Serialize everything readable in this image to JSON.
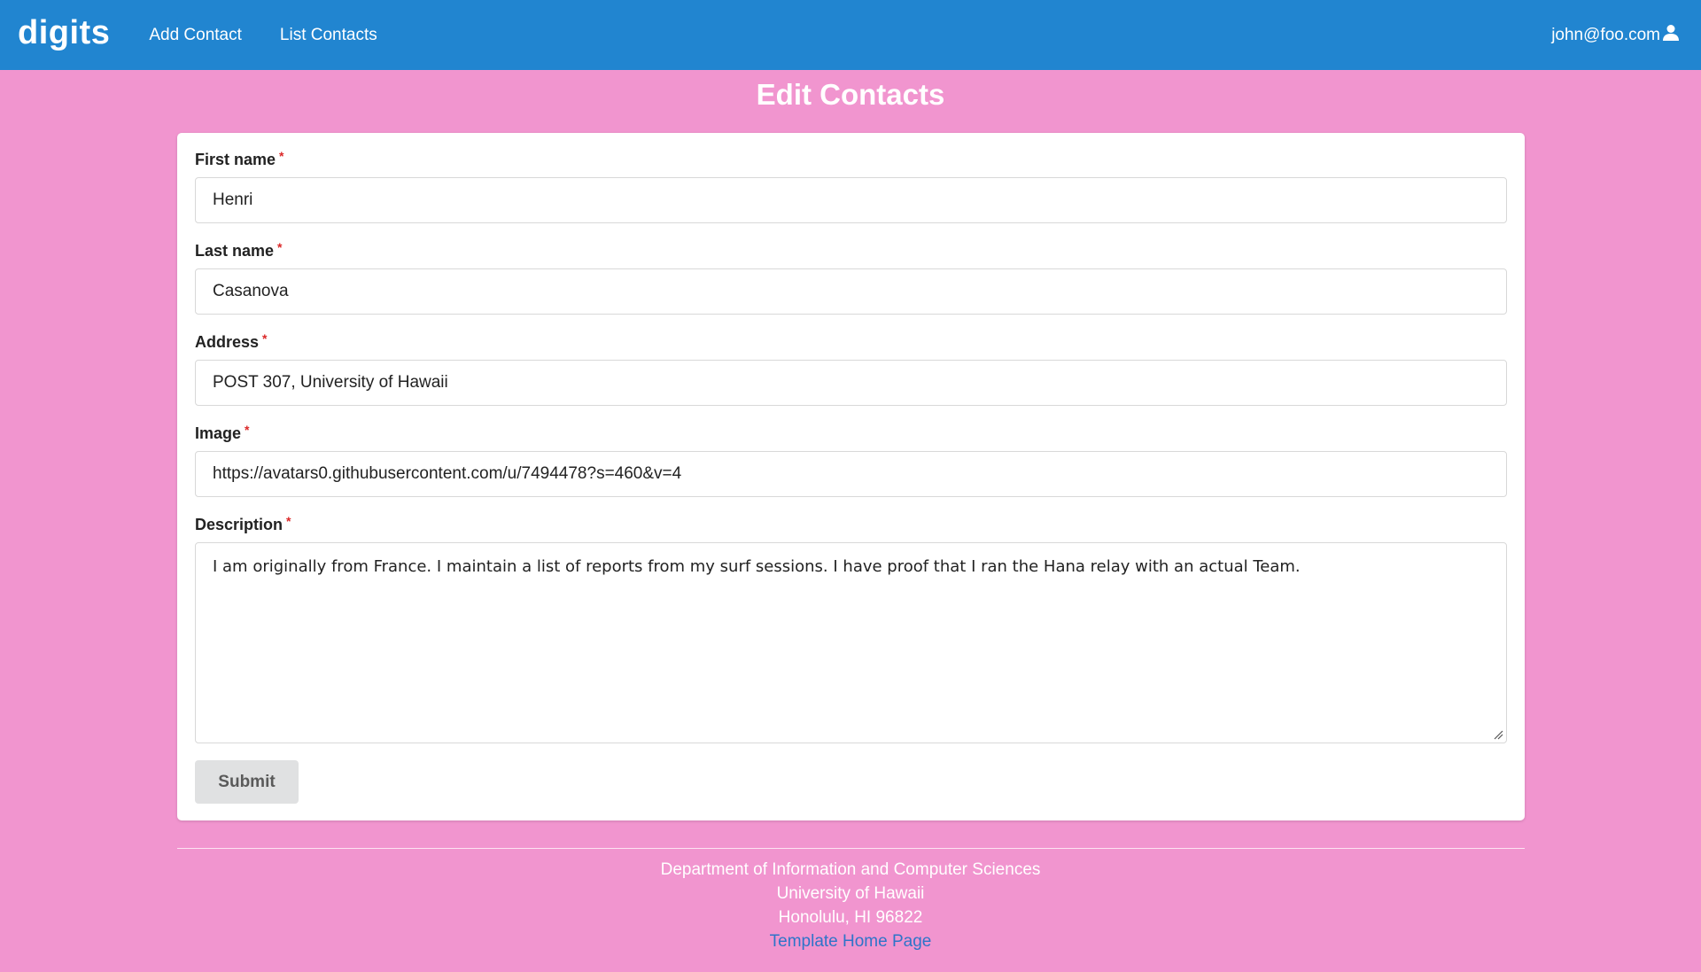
{
  "navbar": {
    "brand": "digits",
    "links": [
      "Add Contact",
      "List Contacts"
    ],
    "user_email": "john@foo.com",
    "user_icon": "user-icon"
  },
  "page": {
    "title": "Edit Contacts"
  },
  "form": {
    "required_mark": "*",
    "fields": {
      "first_name": {
        "label": "First name",
        "value": "Henri"
      },
      "last_name": {
        "label": "Last name",
        "value": "Casanova"
      },
      "address": {
        "label": "Address",
        "value": "POST 307, University of Hawaii"
      },
      "image": {
        "label": "Image",
        "value": "https://avatars0.githubusercontent.com/u/7494478?s=460&v=4"
      },
      "description": {
        "label": "Description",
        "value": "I am originally from France. I maintain a list of reports from my surf sessions. I have proof that I ran the Hana relay with an actual Team."
      }
    },
    "submit_label": "Submit"
  },
  "footer": {
    "line1": "Department of Information and Computer Sciences",
    "line2": "University of Hawaii",
    "line3": "Honolulu, HI 96822",
    "link": "Template Home Page"
  },
  "colors": {
    "navbar": "#2185d0",
    "background": "#f195cf",
    "required": "#db2828",
    "link": "#2e74c9"
  }
}
